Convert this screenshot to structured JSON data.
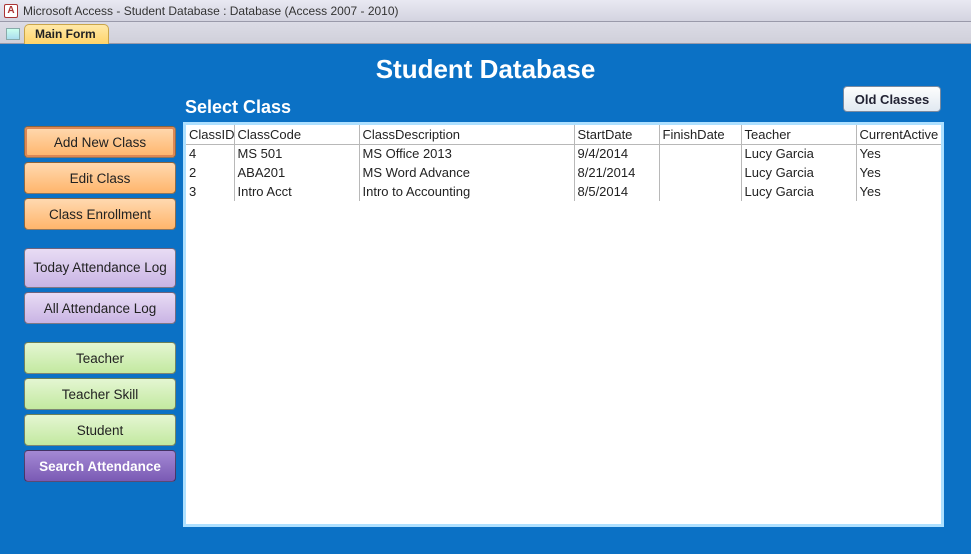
{
  "window": {
    "title": "Microsoft Access - Student Database : Database (Access 2007 - 2010)",
    "tab": "Main Form"
  },
  "header": {
    "title": "Student Database",
    "section_label": "Select Class"
  },
  "buttons": {
    "old_classes": "Old Classes",
    "side": {
      "add_new_class": "Add New Class",
      "edit_class": "Edit Class",
      "class_enrollment": "Class Enrollment",
      "today_attendance_log": "Today Attendance Log",
      "all_attendance_log": "All Attendance Log",
      "teacher": "Teacher",
      "teacher_skill": "Teacher Skill",
      "student": "Student",
      "search_attendance": "Search Attendance"
    }
  },
  "grid": {
    "columns": {
      "class_id": "ClassID",
      "class_code": "ClassCode",
      "class_description": "ClassDescription",
      "start_date": "StartDate",
      "finish_date": "FinishDate",
      "teacher": "Teacher",
      "current_active": "CurrentActive"
    },
    "rows": [
      {
        "class_id": "4",
        "class_code": "MS 501",
        "class_description": "MS Office 2013",
        "start_date": "9/4/2014",
        "finish_date": "",
        "teacher": "Lucy Garcia",
        "current_active": "Yes"
      },
      {
        "class_id": "2",
        "class_code": "ABA201",
        "class_description": "MS Word Advance",
        "start_date": "8/21/2014",
        "finish_date": "",
        "teacher": "Lucy Garcia",
        "current_active": "Yes"
      },
      {
        "class_id": "3",
        "class_code": "Intro Acct",
        "class_description": "Intro to Accounting",
        "start_date": "8/5/2014",
        "finish_date": "",
        "teacher": "Lucy Garcia",
        "current_active": "Yes"
      }
    ]
  }
}
